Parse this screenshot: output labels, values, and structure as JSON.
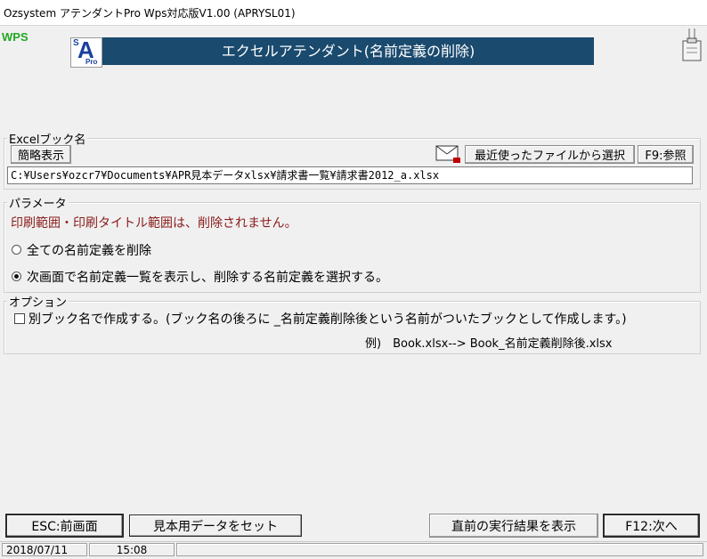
{
  "window": {
    "title": "Ozsystem アテンダントPro Wps対応版V1.00 (APRYSL01)"
  },
  "header": {
    "wps_logo": "WPS",
    "logo_text": {
      "s": "S",
      "a": "A",
      "pro": "Pro"
    },
    "banner_title": "エクセルアテンダント(名前定義の削除)"
  },
  "excel_book": {
    "group_label": "Excelブック名",
    "simple_display_button": "簡略表示",
    "recent_button": "最近使ったファイルから選択",
    "browse_button": "F9:参照",
    "path_value": "C:¥Users¥ozcr7¥Documents¥APR見本データxlsx¥請求書一覧¥請求書2012_a.xlsx"
  },
  "parameters": {
    "group_label": "パラメータ",
    "note": "印刷範囲・印刷タイトル範囲は、削除されません。",
    "options": [
      {
        "label": "全ての名前定義を削除",
        "selected": false
      },
      {
        "label": "次画面で名前定義一覧を表示し、削除する名前定義を選択する。",
        "selected": true
      }
    ]
  },
  "options": {
    "group_label": "オプション",
    "checkbox_label": "別ブック名で作成する。(ブック名の後ろに _名前定義削除後という名前がついたブックとして作成します。)",
    "checked": false,
    "example": "例)　Book.xlsx--> Book_名前定義削除後.xlsx"
  },
  "footer_buttons": {
    "esc": "ESC:前画面",
    "sample": "見本用データをセット",
    "last_result": "直前の実行結果を表示",
    "next": "F12:次へ"
  },
  "status": {
    "date": "2018/07/11",
    "time": "15:08"
  },
  "colors": {
    "banner": "#1a4a6e",
    "note_red": "#8b1a1a",
    "wps_green": "#22a822",
    "logo_blue": "#1a3fa0"
  }
}
